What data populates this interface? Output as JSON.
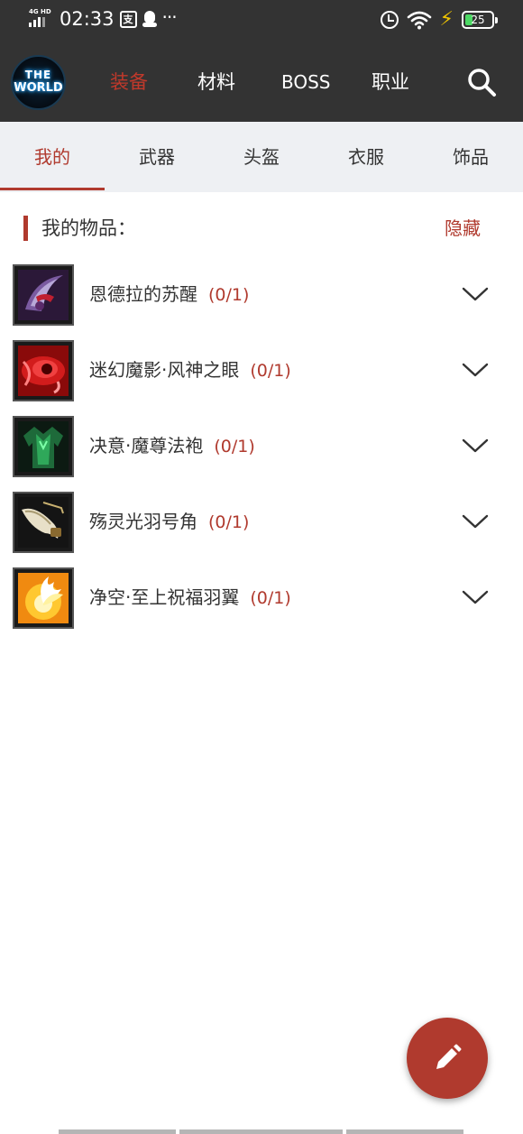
{
  "status_bar": {
    "network": "4G HD",
    "time": "02:33",
    "app_badge": "支",
    "more": "···",
    "battery": "25"
  },
  "header": {
    "logo_line1": "THE",
    "logo_line2": "WORLD",
    "nav": [
      {
        "label": "装备",
        "active": true
      },
      {
        "label": "材料",
        "active": false
      },
      {
        "label": "BOSS",
        "active": false
      },
      {
        "label": "职业",
        "active": false
      }
    ]
  },
  "tabs": [
    {
      "label": "我的",
      "active": true
    },
    {
      "label": "武器",
      "active": false
    },
    {
      "label": "头盔",
      "active": false
    },
    {
      "label": "衣服",
      "active": false
    },
    {
      "label": "饰品",
      "active": false
    }
  ],
  "section": {
    "title": "我的物品：",
    "action": "隐藏"
  },
  "items": [
    {
      "name": "恩德拉的苏醒",
      "count": "(0/1)",
      "icon": "purple-scythe-icon"
    },
    {
      "name": "迷幻魔影·风神之眼",
      "count": "(0/1)",
      "icon": "red-eye-icon"
    },
    {
      "name": "决意·魔尊法袍",
      "count": "(0/1)",
      "icon": "green-robe-icon"
    },
    {
      "name": "殇灵光羽号角",
      "count": "(0/1)",
      "icon": "horn-icon"
    },
    {
      "name": "净空·至上祝福羽翼",
      "count": "(0/1)",
      "icon": "golden-wings-icon"
    }
  ],
  "colors": {
    "accent": "#b03a2e",
    "header_bg": "#333333",
    "tab_bg": "#eef0f3"
  }
}
